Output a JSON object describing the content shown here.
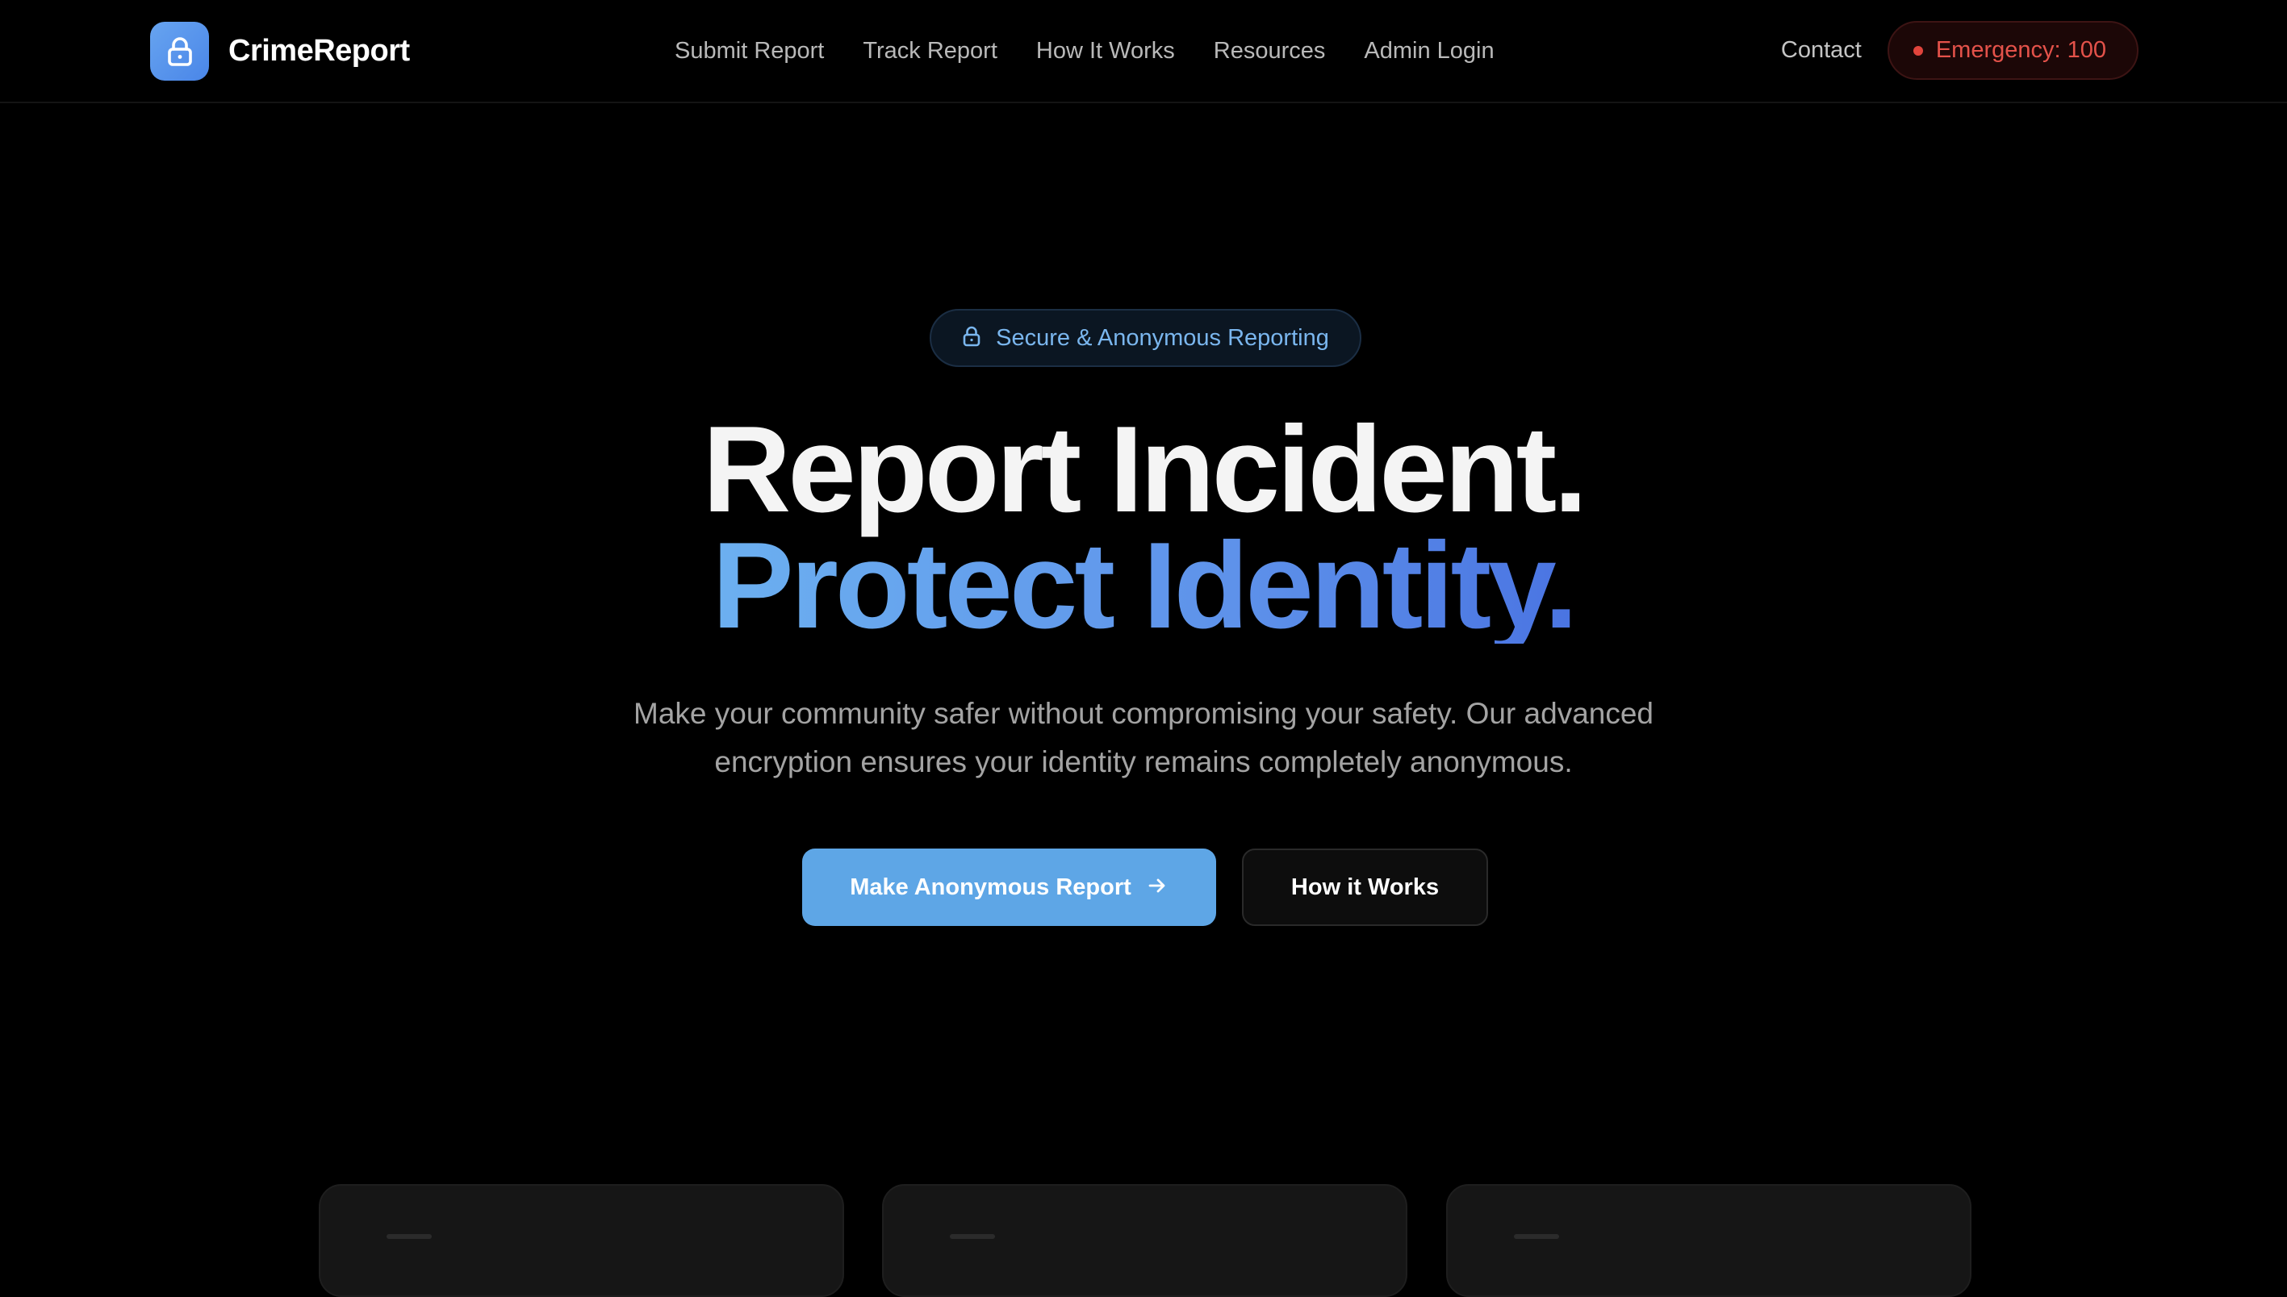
{
  "brand": {
    "name": "CrimeReport",
    "logo_icon": "lock-icon"
  },
  "nav": {
    "links": [
      "Submit Report",
      "Track Report",
      "How It Works",
      "Resources",
      "Admin Login"
    ],
    "contact": "Contact",
    "emergency": "Emergency: 100"
  },
  "hero": {
    "badge": "Secure & Anonymous Reporting",
    "title_line1": "Report Incident.",
    "title_line2": "Protect Identity.",
    "subtitle_line1": "Make your community safer without compromising your safety. Our advanced",
    "subtitle_line2": "encryption ensures your identity remains completely anonymous.",
    "primary_cta": "Make Anonymous Report",
    "secondary_cta": "How it Works"
  },
  "colors": {
    "accent": "#5ea6e6",
    "gradient_start": "#6cb0f0",
    "gradient_end": "#4a74e2",
    "emergency": "#e4524a",
    "background": "#000000"
  }
}
